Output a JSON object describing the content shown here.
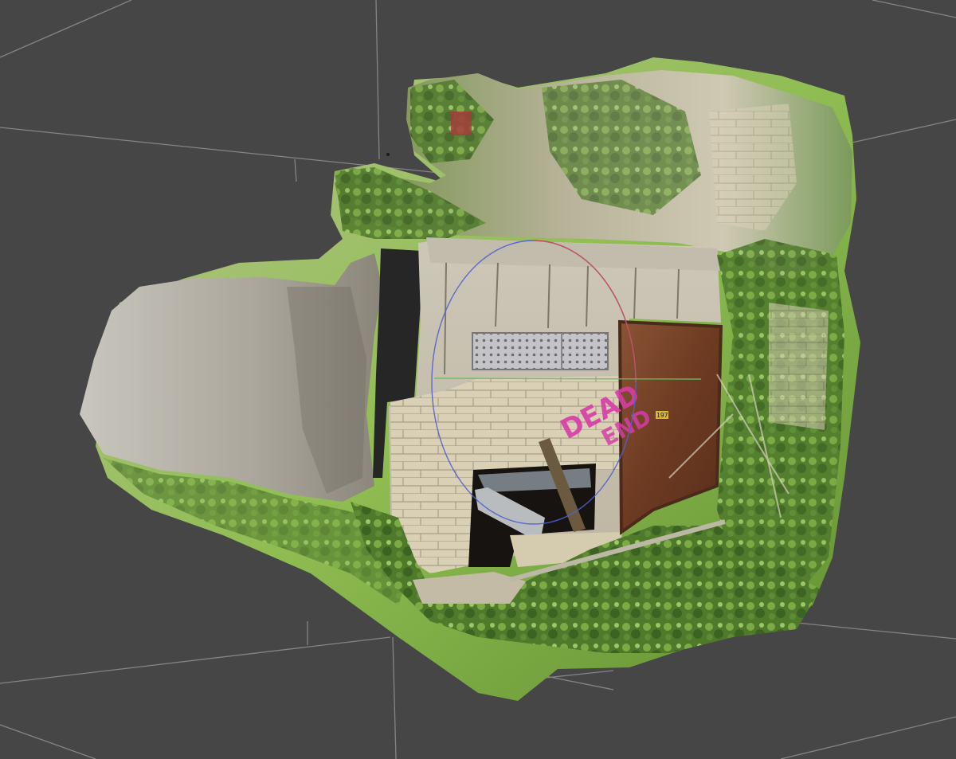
{
  "viewport": {
    "background_color": "#464646",
    "grid_color": "#9a9a9a",
    "gizmo_colors": {
      "x_axis": "#d05050",
      "y_axis": "#60c060",
      "z_axis": "#5060d0"
    }
  },
  "model": {
    "graffiti_lines": [
      "DEAD",
      "END"
    ],
    "door_sign": "197",
    "colors": {
      "concrete": "#b9b4a8",
      "brick": "#d9d0b6",
      "rusted_door": "#7a4228",
      "vegetation": "#6f9a3c",
      "mesh_green": "#8cc050"
    }
  }
}
